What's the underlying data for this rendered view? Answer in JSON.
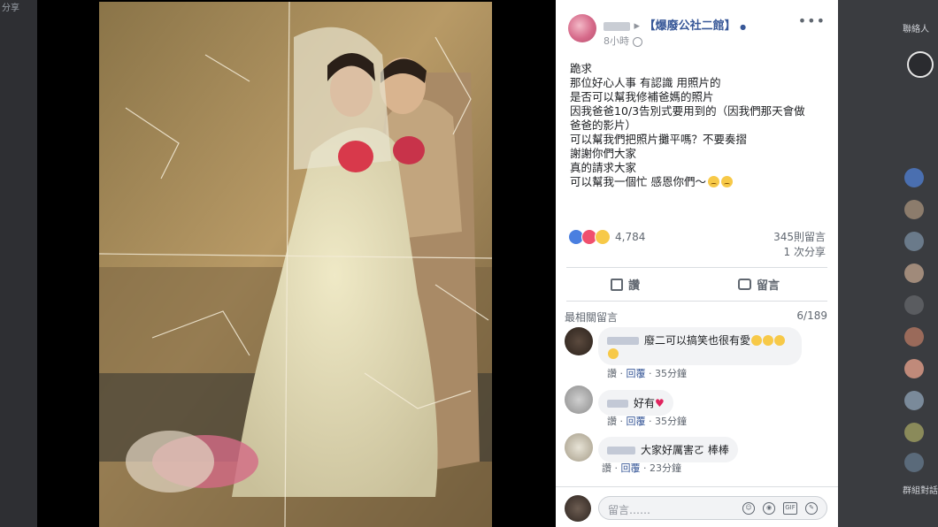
{
  "left_strip": {
    "tiny_text": "分享"
  },
  "post": {
    "group_name": "【爆廢公社二館】",
    "sub_text": "8小時",
    "more_icon": "more-icon",
    "lines": [
      "跪求",
      "那位好心人事 有認識 用照片的",
      "是否可以幫我修補爸媽的照片",
      "因我爸爸10/3告別式要用到的（因我們那天會做",
      "爸爸的影片）",
      "可以幫我們把照片攤平嗎？不要奏摺",
      "謝謝你們大家",
      "真的請求大家",
      "可以幫我一個忙 感恩你們～"
    ],
    "reaction_count": "4,784",
    "comments_count": "345則留言",
    "shares_count": "1 次分享",
    "like_label": "讚",
    "comment_label": "留言"
  },
  "comments_section": {
    "header": "最相關留言",
    "count": "6/189",
    "items": [
      {
        "text": "廢二可以搞笑也很有愛",
        "reply": "回覆",
        "time": "35分鐘",
        "prefix": "讚 ·"
      },
      {
        "text": "好有",
        "reply": "回覆",
        "time": "35分鐘",
        "prefix": "讚 ·"
      },
      {
        "text": "大家好厲害ㄛ 棒棒",
        "reply": "回覆",
        "time": "23分鐘",
        "prefix": "讚 ·"
      }
    ]
  },
  "compose": {
    "placeholder": "留言……"
  },
  "right_strip": {
    "top_label": "聯絡人",
    "bottom_label": "群組對話"
  },
  "colors": {
    "link": "#385898",
    "panel_bg": "#ffffff",
    "dark_bg": "#3b3d42"
  }
}
